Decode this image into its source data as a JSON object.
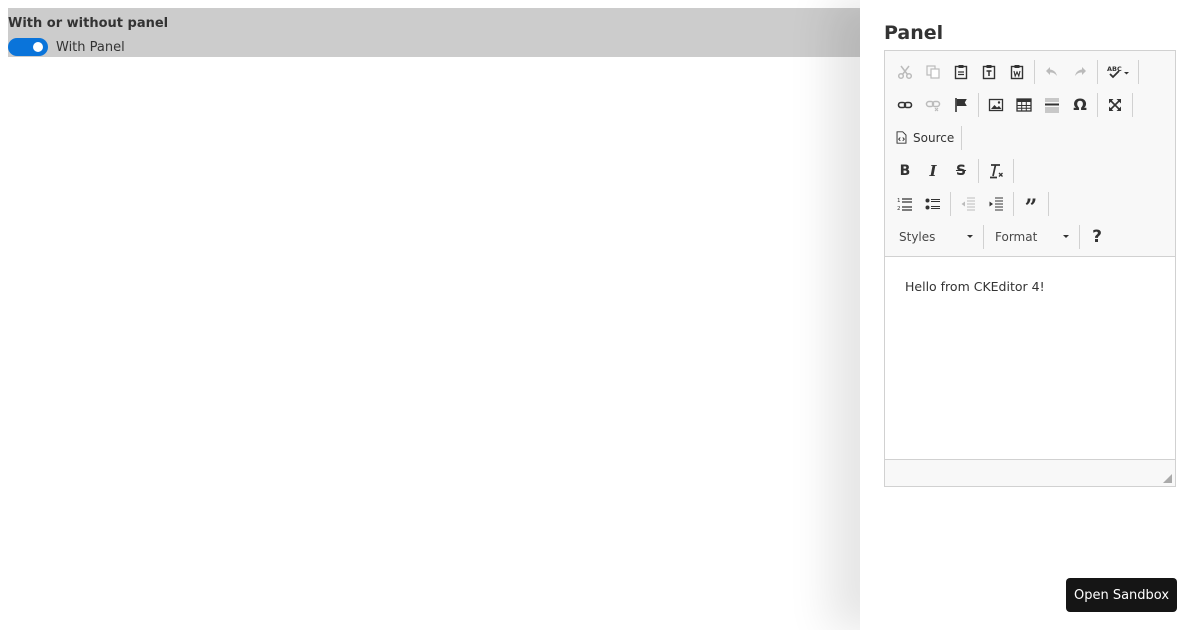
{
  "topbar": {
    "title": "With or without panel",
    "toggle": {
      "label": "With Panel",
      "checked": true,
      "color": "#0a74da"
    }
  },
  "panel": {
    "title": "Panel",
    "editor": {
      "toolbar": {
        "source_label": "Source",
        "styles_label": "Styles",
        "format_label": "Format",
        "help_label": "?",
        "icons": [
          "cut-icon",
          "copy-icon",
          "paste-icon",
          "paste-text-icon",
          "paste-word-icon",
          "undo-icon",
          "redo-icon",
          "spellcheck-icon",
          "link-icon",
          "unlink-icon",
          "anchor-icon",
          "image-icon",
          "table-icon",
          "horizontal-rule-icon",
          "special-char-icon",
          "maximize-icon",
          "source-icon",
          "bold-icon",
          "italic-icon",
          "strike-icon",
          "remove-format-icon",
          "numbered-list-icon",
          "bulleted-list-icon",
          "outdent-icon",
          "indent-icon",
          "blockquote-icon"
        ]
      },
      "content": "Hello from CKEditor 4!"
    }
  },
  "open_sandbox_label": "Open Sandbox"
}
